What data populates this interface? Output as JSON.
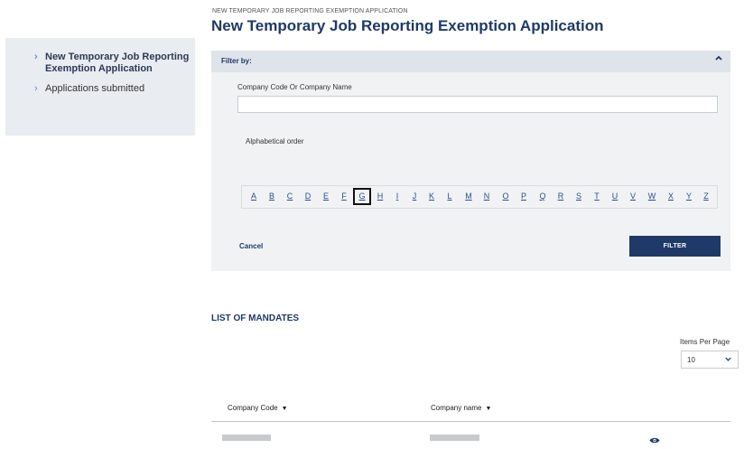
{
  "sidebar": {
    "items": [
      {
        "label": "New Temporary Job Reporting Exemption Application"
      },
      {
        "label": "Applications submitted"
      }
    ]
  },
  "header": {
    "breadcrumb": "NEW TEMPORARY JOB REPORTING EXEMPTION APPLICATION",
    "title": "New Temporary Job Reporting Exemption Application"
  },
  "filter": {
    "heading": "Filter by:",
    "field_label": "Company Code Or Company Name",
    "search_value": "",
    "search_placeholder": "",
    "alpha_label": "Alphabetical order",
    "letters": [
      "A",
      "B",
      "C",
      "D",
      "E",
      "F",
      "G",
      "H",
      "I",
      "J",
      "K",
      "L",
      "M",
      "N",
      "O",
      "P",
      "Q",
      "R",
      "S",
      "T",
      "U",
      "V",
      "W",
      "X",
      "Y",
      "Z"
    ],
    "selected_letter": "G",
    "cancel_label": "Cancel",
    "filter_label": "FILTER"
  },
  "list": {
    "title": "LIST OF MANDATES",
    "items_per_page_label": "Items Per Page",
    "items_per_page_value": "10",
    "columns": [
      {
        "label": "Company Code"
      },
      {
        "label": "Company name"
      }
    ]
  },
  "icons": {
    "collapse": "chevron-up-icon",
    "sort": "sort-down-icon",
    "view": "eye-icon",
    "sidebar_bullet": "chevron-right-icon"
  },
  "colors": {
    "brand": "#1f3a68",
    "link": "#2a4f8f",
    "panel_bg": "#f1f2f4",
    "panel_header_bg": "#dfe3ea",
    "sidebar_bg": "#e9ecf1"
  }
}
